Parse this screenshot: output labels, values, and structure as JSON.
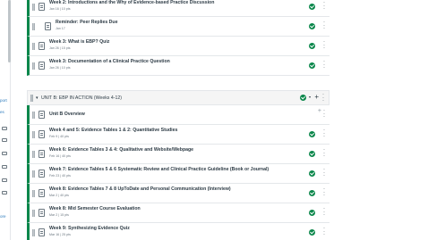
{
  "module_a": {
    "items": [
      {
        "title": "Week 2: Introductions and the Why of Evidence-based Practice Discussion",
        "meta": "Jan 16  |  10 pts",
        "indent": false
      },
      {
        "title": "Reminder: Peer Replies Due",
        "meta": "Jan 17",
        "indent": true
      },
      {
        "title": "Week 3: What is EBP? Quiz",
        "meta": "Jan 26  |  15 pts",
        "indent": false
      },
      {
        "title": "Week 3: Documentation of a Clinical Practice Question",
        "meta": "Jan 26  |  10 pts",
        "indent": false
      }
    ]
  },
  "module_b": {
    "header_title": "UNIT B: EBP IN ACTION (Weeks 4-12)",
    "items": [
      {
        "title": "Unit B Overview",
        "meta": "",
        "indent": false
      },
      {
        "title": "Week 4 and 5: Evidence Tables 1 & 2: Quantitative Studies",
        "meta": "Feb 9  |  40 pts",
        "indent": false
      },
      {
        "title": "Week 6: Evidence Tables 3 & 4: Qualitative and Website/Webpage",
        "meta": "Feb 16  |  40 pts",
        "indent": false
      },
      {
        "title": "Week 7: Evidence Tables 5 & 6 Systematic Review and Clinical Practice Guideline (Book or Journal)",
        "meta": "Feb 23  |  40 pts",
        "indent": false
      },
      {
        "title": "Week 8: Evidence Tables 7 & 8 UpToDate and Personal Communication (Interview)",
        "meta": "Mar 2  |  40 pts",
        "indent": false
      },
      {
        "title": "Week 8: Mid Semester Course Evaluation",
        "meta": "Mar 2  |  15 pts",
        "indent": false
      },
      {
        "title": "Week 9: Synthesizing Evidence Quiz",
        "meta": "Mar 16  |  25 pts",
        "indent": false
      }
    ]
  },
  "left_strip_fragments": [
    "port",
    "es",
    "ore"
  ],
  "colors": {
    "published": "#0b874b",
    "text": "#2d3b45",
    "muted": "#6b7780"
  }
}
